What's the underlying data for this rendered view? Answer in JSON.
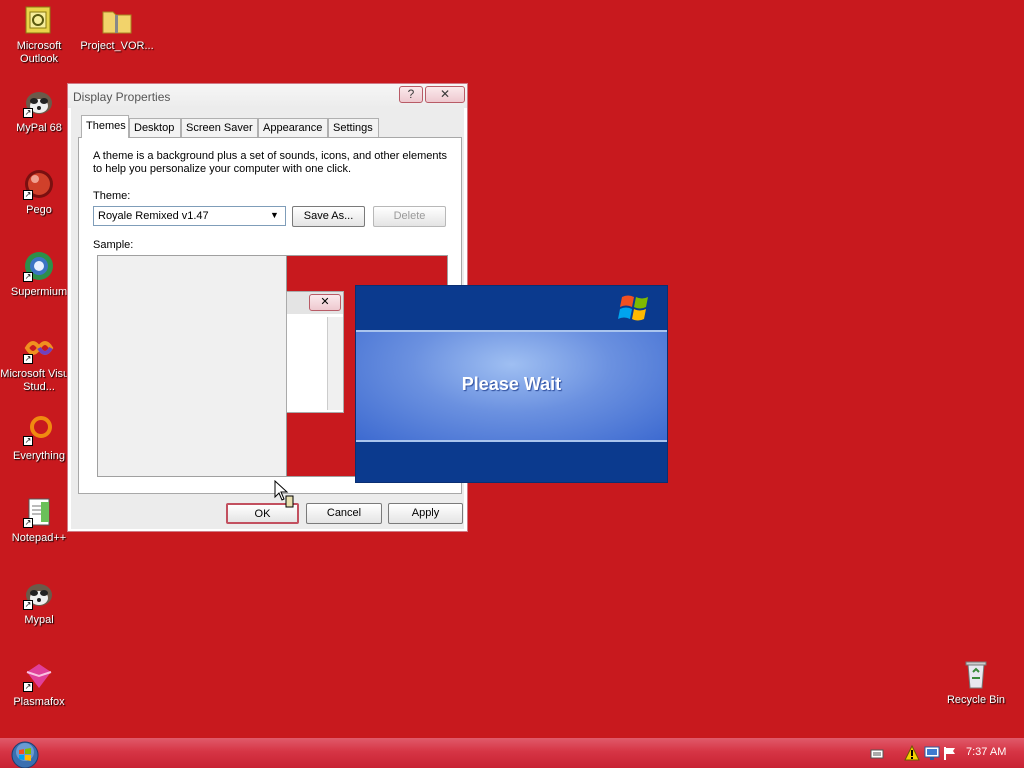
{
  "desktop": {
    "background_color": "#c8191e",
    "icons": [
      {
        "label": "Microsoft Outlook",
        "icon": "outlook-icon"
      },
      {
        "label": "Project_VOR...",
        "icon": "zip-folder-icon"
      },
      {
        "label": "MyPal 68",
        "icon": "raccoon-icon"
      },
      {
        "label": "Pego",
        "icon": "red-ball-icon"
      },
      {
        "label": "Supermium",
        "icon": "globe-icon"
      },
      {
        "label": "Microsoft Visual Stud...",
        "icon": "visual-studio-icon"
      },
      {
        "label": "Everything",
        "icon": "search-ring-icon"
      },
      {
        "label": "Notepad++",
        "icon": "notepad-plus-plus-icon"
      },
      {
        "label": "Mypal",
        "icon": "raccoon-icon"
      },
      {
        "label": "Plasmafox",
        "icon": "plasmafox-icon"
      },
      {
        "label": "Recycle Bin",
        "icon": "recycle-bin-icon"
      }
    ]
  },
  "display_properties": {
    "title": "Display Properties",
    "help_button": "?",
    "close_button": "✕",
    "tabs": [
      {
        "label": "Themes",
        "active": true
      },
      {
        "label": "Desktop",
        "active": false
      },
      {
        "label": "Screen Saver",
        "active": false
      },
      {
        "label": "Appearance",
        "active": false
      },
      {
        "label": "Settings",
        "active": false
      }
    ],
    "description": "A theme is a background plus a set of sounds, icons, and other elements to help you personalize your computer with one click.",
    "theme_label": "Theme:",
    "theme_value": "Royale Remixed v1.47",
    "save_as_label": "Save As...",
    "delete_label": "Delete",
    "sample_label": "Sample:",
    "ok_label": "OK",
    "cancel_label": "Cancel",
    "apply_label": "Apply"
  },
  "wait_dialog": {
    "message": "Please Wait"
  },
  "taskbar": {
    "clock": "7:37 AM",
    "tray_icons": [
      "keyboard-icon",
      "warning-icon",
      "network-icon",
      "flag-icon"
    ]
  }
}
